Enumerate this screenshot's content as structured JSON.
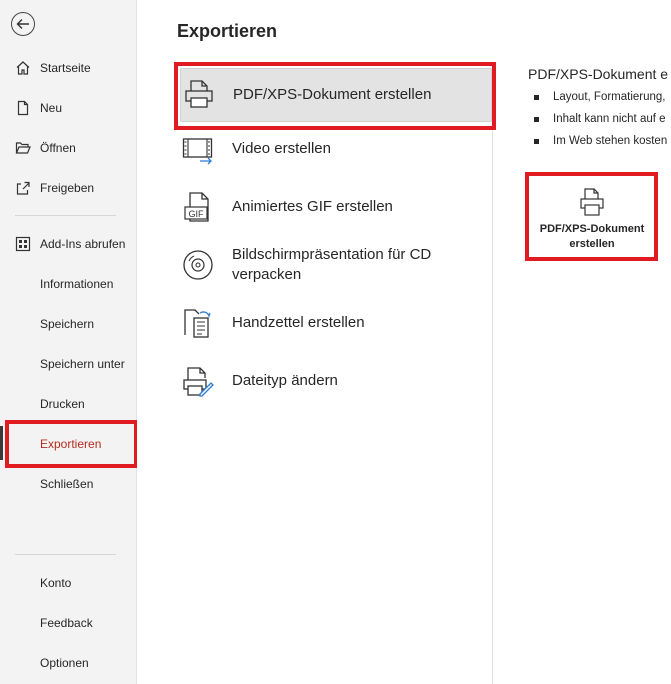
{
  "sidebar": {
    "items": [
      {
        "label": "Startseite",
        "icon": "home-icon"
      },
      {
        "label": "Neu",
        "icon": "new-document-icon"
      },
      {
        "label": "Öffnen",
        "icon": "open-folder-icon"
      },
      {
        "label": "Freigeben",
        "icon": "share-icon"
      },
      {
        "label": "Add-Ins abrufen",
        "icon": "add-ins-grid-icon"
      },
      {
        "label": "Informationen"
      },
      {
        "label": "Speichern"
      },
      {
        "label": "Speichern unter"
      },
      {
        "label": "Drucken"
      },
      {
        "label": "Exportieren",
        "active": true
      },
      {
        "label": "Schließen"
      },
      {
        "label": "Konto"
      },
      {
        "label": "Feedback"
      },
      {
        "label": "Optionen"
      }
    ]
  },
  "main": {
    "title": "Exportieren",
    "options": [
      {
        "label": "PDF/XPS-Dokument erstellen",
        "icon": "pdf-printer-icon",
        "selected": true
      },
      {
        "label": "Video erstellen",
        "icon": "video-film-icon"
      },
      {
        "label": "Animiertes GIF erstellen",
        "icon": "gif-file-icon",
        "badge": "GIF"
      },
      {
        "label": "Bildschirmpräsentation für CD verpacken",
        "icon": "cd-disc-icon"
      },
      {
        "label": "Handzettel erstellen",
        "icon": "handout-icon"
      },
      {
        "label": "Dateityp ändern",
        "icon": "change-filetype-icon"
      }
    ]
  },
  "detail": {
    "title": "PDF/XPS-Dokument e",
    "bullets": [
      "Layout, Formatierung,",
      "Inhalt kann nicht auf e",
      "Im Web stehen kosten"
    ],
    "button_label": "PDF/XPS-Dokument erstellen",
    "button_icon": "pdf-printer-icon"
  },
  "colors": {
    "active_text": "#b52b1f",
    "highlight_box": "#e01b22",
    "selected_bg": "#e3e3e3",
    "sidebar_bg": "#f3f3f3"
  }
}
